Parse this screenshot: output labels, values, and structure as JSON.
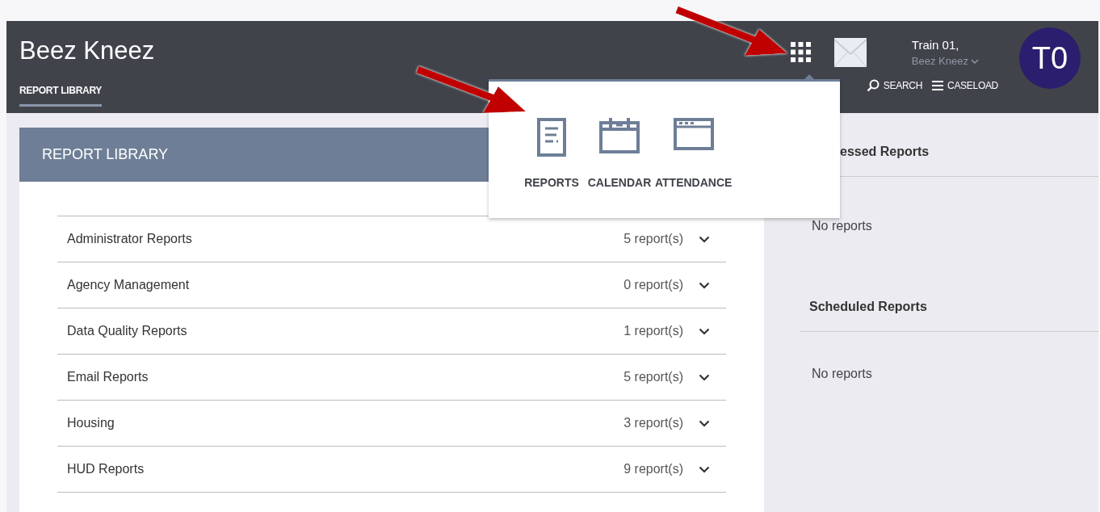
{
  "app": {
    "title": "Beez Kneez",
    "tabs": [
      {
        "label": "REPORT LIBRARY",
        "selected": true
      }
    ]
  },
  "user": {
    "name": "Train 01,",
    "organization": "Beez Kneez",
    "initials": "T0"
  },
  "header_links": [
    {
      "kind": "search",
      "label": "SEARCH"
    },
    {
      "kind": "menu",
      "label": "CASELOAD"
    }
  ],
  "report_library": {
    "title": "REPORT LIBRARY",
    "categories": [
      {
        "name": "Administrator Reports",
        "count": "5 report(s)",
        "expanded": false
      },
      {
        "name": "Agency Management",
        "count": "0 report(s)",
        "expanded": false
      },
      {
        "name": "Data Quality Reports",
        "count": "1 report(s)",
        "expanded": false
      },
      {
        "name": "Email Reports",
        "count": "5 report(s)",
        "expanded": false
      },
      {
        "name": "Housing",
        "count": "3 report(s)",
        "expanded": false
      },
      {
        "name": "HUD Reports",
        "count": "9 report(s)",
        "expanded": false
      }
    ]
  },
  "side_panel": {
    "sections": [
      {
        "title": "essed Reports",
        "empty_text": "No reports"
      },
      {
        "title": "Scheduled Reports",
        "empty_text": "No reports"
      }
    ]
  },
  "apps_menu": {
    "open": true,
    "items": [
      {
        "kind": "reports",
        "label": "REPORTS"
      },
      {
        "kind": "calendar",
        "label": "CALENDAR"
      },
      {
        "kind": "attendance",
        "label": "ATTENDANCE"
      }
    ]
  }
}
